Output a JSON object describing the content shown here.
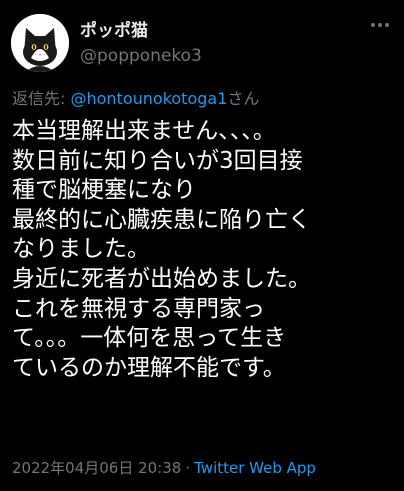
{
  "author": {
    "display_name": "ポッポ猫",
    "handle": "@popponeko3"
  },
  "reply": {
    "prefix": "返信先: ",
    "mention": "@hontounokotoga1",
    "suffix": "さん"
  },
  "body_lines": [
    "本当理解出来ません、、、。",
    "数日前に知り合いが3回目接",
    "種で脳梗塞になり",
    "最終的に心臓疾患に陥り亡く",
    "なりました。",
    "身近に死者が出始めました。",
    "これを無視する専門家っ",
    "て。。。一体何を思って生き",
    "ているのか理解不能です。"
  ],
  "meta": {
    "timestamp": "2022年04月06日 20:38",
    "separator": "·",
    "source": "Twitter Web App"
  },
  "icons": {
    "avatar": "cat-avatar-icon",
    "more": "more-options-icon"
  },
  "colors": {
    "background": "#000000",
    "text": "#ffffff",
    "muted": "#71767b",
    "link": "#1d9bf0"
  }
}
